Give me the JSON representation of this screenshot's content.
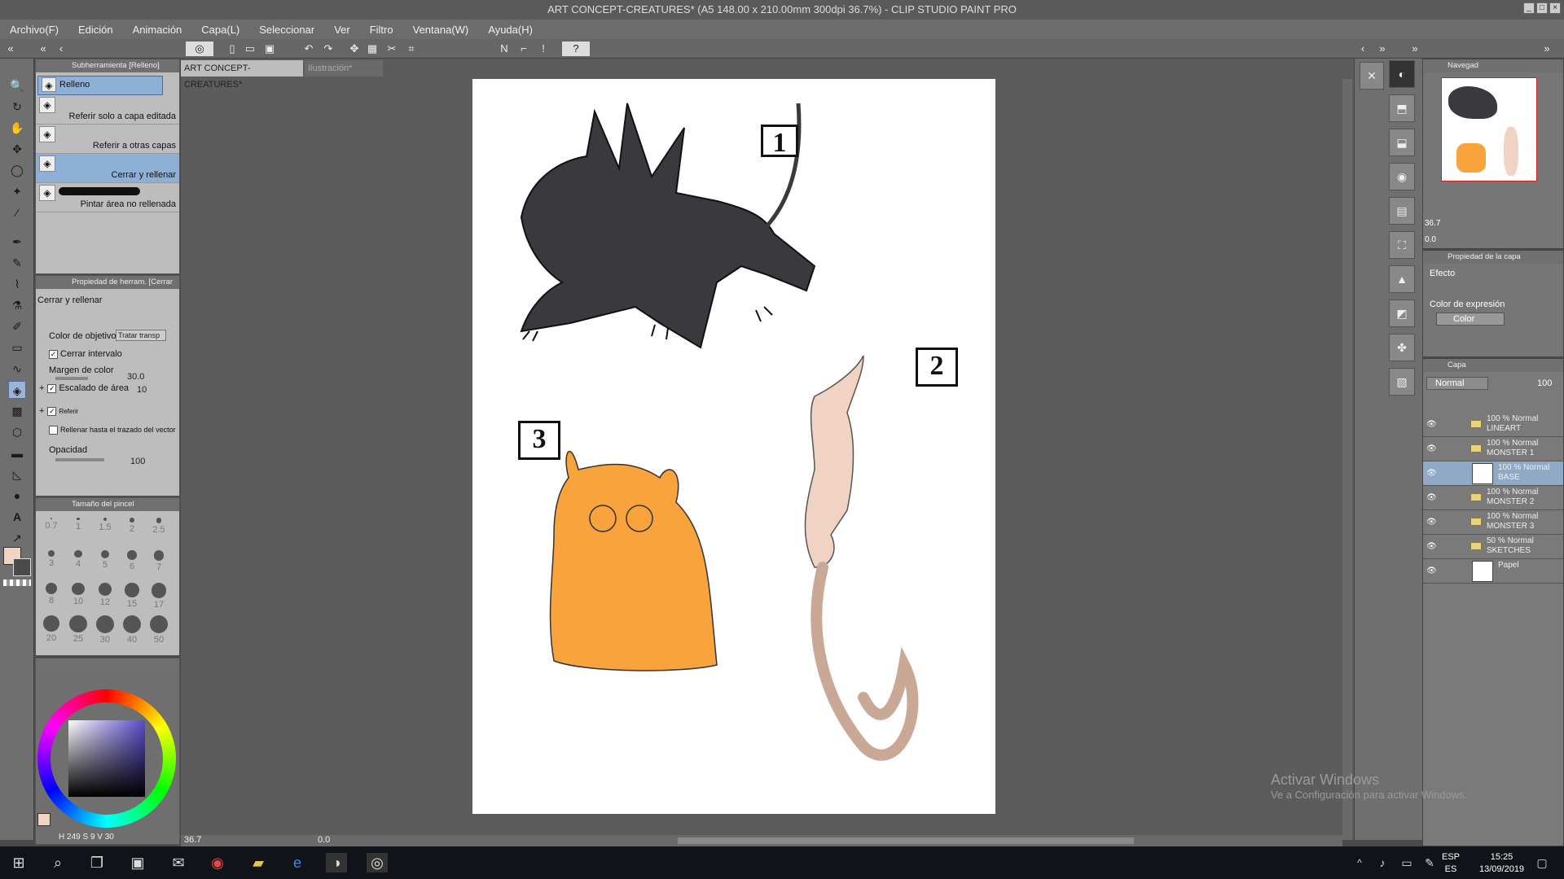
{
  "window": {
    "title": "ART CONCEPT-CREATURES* (A5 148.00 x 210.00mm 300dpi 36.7%) - CLIP STUDIO PAINT PRO"
  },
  "menu": [
    "Archivo(F)",
    "Edición",
    "Animación",
    "Capa(L)",
    "Seleccionar",
    "Ver",
    "Filtro",
    "Ventana(W)",
    "Ayuda(H)"
  ],
  "subtool": {
    "header": "Subherramienta [Relleno]",
    "group": "Relleno",
    "items": [
      "Referir solo a capa editada",
      "Referir a otras capas",
      "Cerrar y rellenar",
      "Pintar área no rellenada"
    ]
  },
  "toolprop": {
    "header": "Propiedad de herram. [Cerrar",
    "title": "Cerrar y rellenar",
    "color_obj_label": "Color de objetivo",
    "color_obj_value": "Tratar transp",
    "close_gap": "Cerrar intervalo",
    "margin": "Margen de color",
    "margin_val": "30.0",
    "area_scale": "Escalado de área",
    "area_val": "10",
    "refer": "Referir",
    "fill_vector": "Rellenar hasta el trazado del vector",
    "opacity": "Opacidad",
    "opacity_val": "100"
  },
  "brushsize": {
    "header": "Tamaño del pincel",
    "sizes": [
      "0.7",
      "1",
      "1.5",
      "2",
      "2.5",
      "3",
      "4",
      "5",
      "6",
      "7",
      "8",
      "10",
      "12",
      "15",
      "17",
      "20",
      "25",
      "30",
      "40",
      "50"
    ]
  },
  "colorreadout": {
    "h": "H",
    "h_val": "249",
    "s": "S",
    "s_val": "9",
    "v": "V",
    "v_val": "30"
  },
  "doctabs": [
    "ART CONCEPT-CREATURES*",
    "Ilustración*"
  ],
  "canvas": {
    "labels": [
      "1",
      "2",
      "3"
    ],
    "zoom": "36.7",
    "angle": "0.0"
  },
  "navigator": {
    "header": "Navegad",
    "zoom": "36.7",
    "angle": "0.0"
  },
  "layerprop": {
    "header": "Propiedad de la capa",
    "effect": "Efecto",
    "expr_label": "Color de expresión",
    "expr_value": "Color"
  },
  "layers": {
    "header": "Capa",
    "blend": "Normal",
    "opacity": "100",
    "rows": [
      {
        "pct": "100 % Normal",
        "name": "LINEART"
      },
      {
        "pct": "100 % Normal",
        "name": "MONSTER 1"
      },
      {
        "pct": "100 % Normal",
        "name": "BASE"
      },
      {
        "pct": "100 % Normal",
        "name": "MONSTER 2"
      },
      {
        "pct": "100 % Normal",
        "name": "MONSTER 3"
      },
      {
        "pct": "50 % Normal",
        "name": "SKETCHES"
      },
      {
        "pct": "",
        "name": "Papel"
      }
    ]
  },
  "watermark": {
    "line1": "Activar Windows",
    "line2": "Ve a Configuración para activar Windows."
  },
  "taskbar": {
    "lang1": "ESP",
    "lang2": "ES",
    "time": "15:25",
    "date": "13/09/2019"
  },
  "colors": {
    "accent": "#8fb0d6",
    "orange": "#f9a33c",
    "pink": "#f1d3c3",
    "dark": "#3a3a3e"
  }
}
